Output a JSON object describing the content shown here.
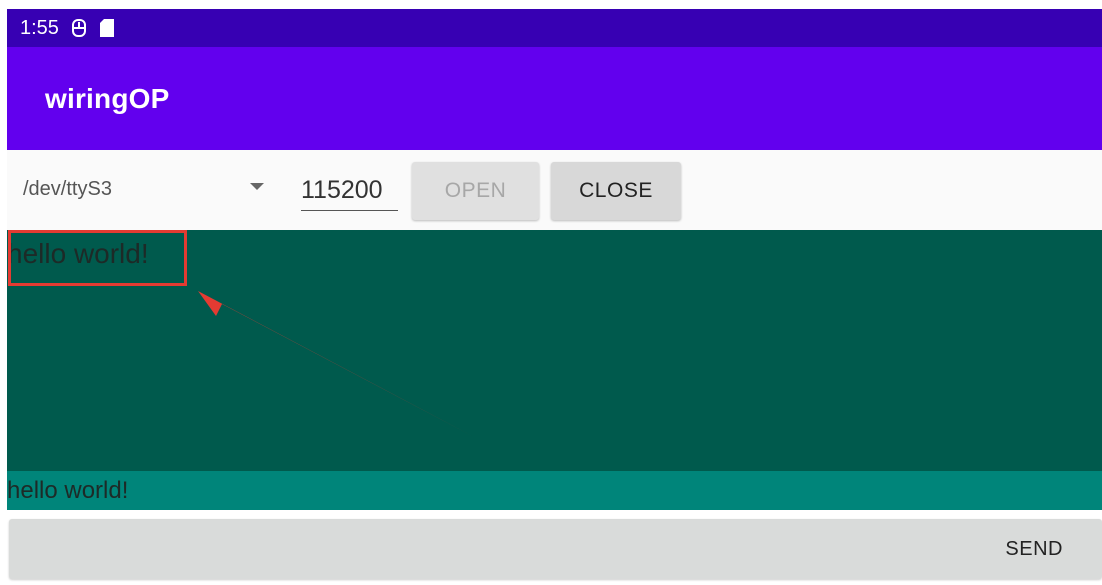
{
  "status_bar": {
    "time": "1:55",
    "icons": [
      "usb-icon",
      "sd-card-icon"
    ]
  },
  "app_bar": {
    "title": "wiringOP"
  },
  "toolbar": {
    "port_select": {
      "selected": "/dev/ttyS3"
    },
    "baud_rate": {
      "value": "115200"
    },
    "open_label": "OPEN",
    "close_label": "CLOSE"
  },
  "receive": {
    "text": "hello world!"
  },
  "send": {
    "input_value": "hello world!",
    "button_label": "SEND"
  },
  "colors": {
    "status_bar": "#3700b3",
    "app_bar": "#6200ee",
    "receive_background": "#005a4d",
    "send_input_background": "#00857a",
    "annotation": "#e43b32"
  }
}
